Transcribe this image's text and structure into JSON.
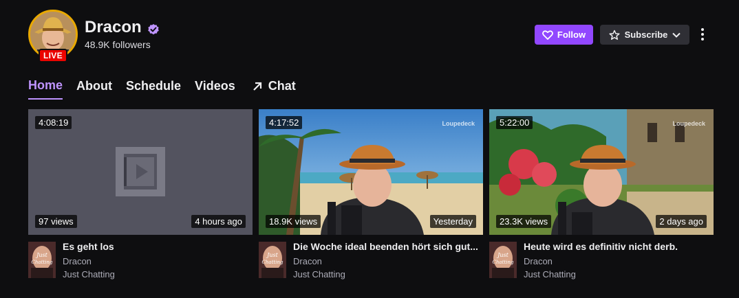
{
  "channel": {
    "name": "Dracon",
    "followers": "48.9K followers",
    "live_label": "LIVE",
    "verified_icon": "verified-badge-icon",
    "accent": "#9147ff"
  },
  "actions": {
    "follow_label": "Follow",
    "subscribe_label": "Subscribe"
  },
  "tabs": [
    {
      "label": "Home",
      "active": true
    },
    {
      "label": "About"
    },
    {
      "label": "Schedule"
    },
    {
      "label": "Videos"
    },
    {
      "label": "Chat",
      "icon": "external-arrow-icon"
    }
  ],
  "videos": [
    {
      "duration": "4:08:19",
      "views": "97 views",
      "ago": "4 hours ago",
      "title": "Es geht los",
      "channel": "Dracon",
      "category": "Just Chatting"
    },
    {
      "duration": "4:17:52",
      "views": "18.9K views",
      "ago": "Yesterday",
      "title": "Die Woche ideal beenden hört sich gut...",
      "channel": "Dracon",
      "category": "Just Chatting",
      "watermark": "Loupedeck"
    },
    {
      "duration": "5:22:00",
      "views": "23.3K views",
      "ago": "2 days ago",
      "title": "Heute wird es definitiv nicht derb.",
      "channel": "Dracon",
      "category": "Just Chatting",
      "watermark": "Loupedeck"
    }
  ],
  "category_art_text": "Just Chatting"
}
